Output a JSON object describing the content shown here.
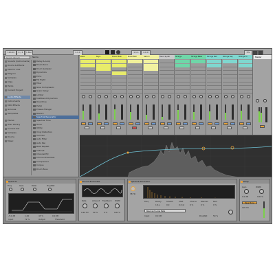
{
  "transport": {
    "boxes": [
      "120.00",
      "4 / 4",
      "1 Bar",
      "1.1.1",
      "1.1.1",
      "4.0.0",
      "0%"
    ],
    "play_icon": "play-icon",
    "stop_icon": "stop-icon",
    "record_icon": "record-icon"
  },
  "browser": {
    "search_placeholder": "Search (Ctrl+F)",
    "categories": [
      {
        "label": "Sounds (Instruments)",
        "selected": false
      },
      {
        "label": "Drums & Effects",
        "selected": false
      },
      {
        "label": "Max for Live",
        "selected": false
      },
      {
        "label": "Plug-ins",
        "selected": false
      },
      {
        "label": "Samples",
        "selected": false
      },
      {
        "label": "Clips",
        "selected": false
      },
      {
        "label": "Packs",
        "selected": false
      },
      {
        "label": "Current Project",
        "selected": false
      },
      {
        "label": "Audio Effects",
        "selected": true
      },
      {
        "label": "Instruments",
        "selected": false
      },
      {
        "label": "MIDI Effects",
        "selected": false
      },
      {
        "label": "Grooves",
        "selected": false
      },
      {
        "label": "Templates",
        "selected": false
      },
      {
        "label": "Places",
        "selected": false
      },
      {
        "label": "User Library",
        "selected": false
      },
      {
        "label": "Current Set",
        "selected": false
      },
      {
        "label": "Samples",
        "selected": false
      },
      {
        "label": "Drums",
        "selected": false
      },
      {
        "label": "Music",
        "selected": false
      }
    ],
    "files_header": "Name",
    "files": [
      {
        "label": "Delay & Loop",
        "selected": false
      },
      {
        "label": "Drum Rack",
        "selected": false
      },
      {
        "label": "Drum Sampler",
        "selected": false
      },
      {
        "label": "Dynamics",
        "selected": false
      },
      {
        "label": "Echo",
        "selected": false
      },
      {
        "label": "EQ Eight",
        "selected": false
      },
      {
        "label": "Filter",
        "selected": false
      },
      {
        "label": "Glue Compressor",
        "selected": false
      },
      {
        "label": "Grain Delay",
        "selected": false
      },
      {
        "label": "Limiter",
        "selected": false
      },
      {
        "label": "Multiband Dynamics",
        "selected": false
      },
      {
        "label": "Overdrive",
        "selected": false
      },
      {
        "label": "Pedal",
        "selected": false
      },
      {
        "label": "Phaser-Flanger",
        "selected": false
      },
      {
        "label": "Reverb",
        "selected": false
      },
      {
        "label": "Spectral Resonator",
        "selected": true
      },
      {
        "label": "Spectral Time",
        "selected": false
      },
      {
        "label": "Tuner",
        "selected": false
      },
      {
        "label": "Utility",
        "selected": false
      },
      {
        "label": "Vinyl Distortion",
        "selected": false
      },
      {
        "label": "Vocoder",
        "selected": false
      },
      {
        "label": "Auto Filter",
        "selected": false
      },
      {
        "label": "Auto Pan",
        "selected": false
      },
      {
        "label": "Beat Repeat",
        "selected": false
      },
      {
        "label": "Cabinet",
        "selected": false
      },
      {
        "label": "Channel EQ",
        "selected": false
      },
      {
        "label": "Chorus-Ensemble",
        "selected": false
      },
      {
        "label": "Compressor",
        "selected": false
      },
      {
        "label": "Corpus",
        "selected": false
      },
      {
        "label": "Drum Buss",
        "selected": false
      }
    ]
  },
  "session": {
    "tracks": [
      {
        "name": "Bass",
        "color": "#e8ec6a",
        "clips": [
          1,
          1,
          0,
          0,
          0,
          0
        ]
      },
      {
        "name": "Keys",
        "color": "#e8ec6a",
        "clips": [
          1,
          1,
          1,
          0,
          0,
          0
        ]
      },
      {
        "name": "Piano Main",
        "color": "#e8ec6a",
        "clips": [
          1,
          1,
          0,
          1,
          0,
          0
        ]
      },
      {
        "name": "Piano Bell",
        "color": "#f0f09a",
        "clips": [
          1,
          0,
          0,
          0,
          0,
          0
        ]
      },
      {
        "name": "Saturn",
        "color": "#f2f2a0",
        "clips": [
          1,
          1,
          1,
          0,
          0,
          0
        ]
      },
      {
        "name": "Hand Synth",
        "color": "#c9c9c9",
        "clips": [
          0,
          0,
          0,
          0,
          0,
          0
        ]
      },
      {
        "name": "Strings",
        "color": "#6fd6a8",
        "clips": [
          1,
          1,
          0,
          0,
          0,
          0
        ]
      },
      {
        "name": "Strings Bass",
        "color": "#6fd6a8",
        "clips": [
          1,
          0,
          0,
          0,
          0,
          0
        ]
      },
      {
        "name": "Strings Pad",
        "color": "#7fd7cf",
        "clips": [
          1,
          1,
          0,
          0,
          0,
          0
        ]
      },
      {
        "name": "Strings Key",
        "color": "#7fd7cf",
        "clips": [
          1,
          0,
          0,
          0,
          0,
          0
        ]
      },
      {
        "name": "Strings Hi",
        "color": "#7fd7cf",
        "clips": [
          1,
          1,
          0,
          0,
          0,
          0
        ]
      }
    ],
    "levels": [
      0.6,
      0.4,
      0.7,
      0.5,
      0.3,
      0.2,
      0.65,
      0.5,
      0.55,
      0.45,
      0.6
    ],
    "master_label": "Master"
  },
  "devices": {
    "d1": {
      "title": "Spectral",
      "params": [
        "Freq",
        "Gain",
        "Ratio",
        "Dry/Wet",
        "Input",
        "Output"
      ],
      "values": [
        "-5.0 dB",
        "1.20",
        "43 %",
        "0.0 dB",
        "72 %",
        "Threshold"
      ]
    },
    "d2": {
      "title": "Chorus-Ensemble",
      "params": [
        "Rate",
        "Amount",
        "Feedback",
        "Width"
      ],
      "values": [
        "0.20 Hz",
        "40 %",
        "0 %",
        "100 %"
      ]
    },
    "d3": {
      "title": "Spectral Resonator",
      "params": [
        "Freq",
        "Decay",
        "Stretch",
        "Shift",
        "Chorus",
        "Wander",
        "Mod",
        "Input",
        "Dry/Wet"
      ],
      "values": [
        "38 Hz",
        "1.6 s",
        "0.0",
        "0.0 st",
        "0 %",
        "0 %",
        "0 %",
        "0.0 dB",
        "50 %"
      ],
      "preset": "Resonant Large Bells"
    },
    "d4": {
      "title": "Utility",
      "params": [
        "Gain",
        "Width",
        "Bass Mono"
      ],
      "values": [
        "0.0 dB",
        "100 %",
        "120 Hz"
      ]
    }
  }
}
